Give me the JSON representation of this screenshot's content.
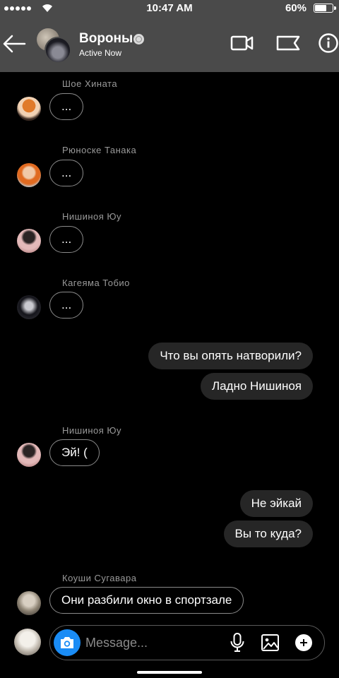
{
  "status_bar": {
    "time": "10:47 AM",
    "battery_percent": "60%",
    "battery_level": 0.6
  },
  "header": {
    "title": "Вороны",
    "subtitle": "Active Now",
    "icons": [
      "back-arrow-icon",
      "video-call-icon",
      "flag-icon",
      "info-icon"
    ]
  },
  "messages": {
    "m1": {
      "sender": "Шое Хината",
      "text": "..."
    },
    "m2": {
      "sender": "Рюноске Танака",
      "text": "..."
    },
    "m3": {
      "sender": "Нишиноя Юу",
      "text": "..."
    },
    "m4": {
      "sender": "Кагеяма Тобио",
      "text": "..."
    },
    "m5": {
      "text": "Что вы опять натворили?"
    },
    "m6": {
      "text": "Ладно Нишиноя"
    },
    "m7": {
      "sender": "Нишиноя Юу",
      "text": "Эй! ("
    },
    "m8": {
      "text": "Не эйкай"
    },
    "m9": {
      "text": "Вы то куда?"
    },
    "m10": {
      "sender": "Коуши Сугавара",
      "text": "Они разбили окно в спортзале"
    }
  },
  "composer": {
    "placeholder": "Message...",
    "icons": [
      "camera-icon",
      "microphone-icon",
      "image-icon",
      "plus-icon"
    ]
  },
  "colors": {
    "header_bg": "#4a4a4a",
    "outgoing_bubble": "#262626",
    "camera_button": "#1a8cf5"
  }
}
